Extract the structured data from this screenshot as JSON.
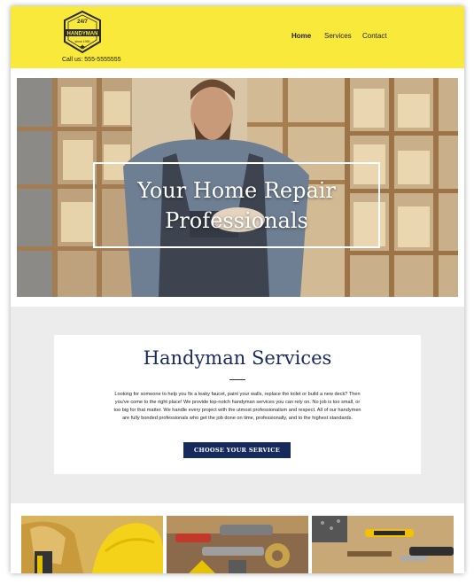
{
  "header": {
    "logo": {
      "top_text": "24/7",
      "name": "HANDYMAN",
      "since": "since 1990"
    },
    "phone": "Call us: 555-5555555",
    "nav": [
      {
        "label": "Home",
        "active": true
      },
      {
        "label": "Services",
        "active": false
      },
      {
        "label": "Contact",
        "active": false
      }
    ]
  },
  "hero": {
    "title": "Your Home Repair Professionals"
  },
  "services": {
    "title": "Handyman Services",
    "description": "Looking for someone to help you fix a leaky faucet, paint your walls, replace the toilet or build a new deck? Then you've come to the right place! We provide top-notch handyman services you can rely on. No job is too small, or too big for that matter. We handle every project with the utmost professionalism and respect. All of our handymen are fully bonded professionals who get the job done on time, professionally, and to the highest standards.",
    "cta_label": "CHOOSE YOUR SERVICE"
  },
  "gallery": [
    {
      "icon": "gloves-hardhat-image"
    },
    {
      "icon": "plumbing-tools-image"
    },
    {
      "icon": "tape-measure-tools-image"
    }
  ],
  "colors": {
    "header_bg": "#f8e93a",
    "navy": "#172a5e",
    "band_grey": "#ececec"
  }
}
